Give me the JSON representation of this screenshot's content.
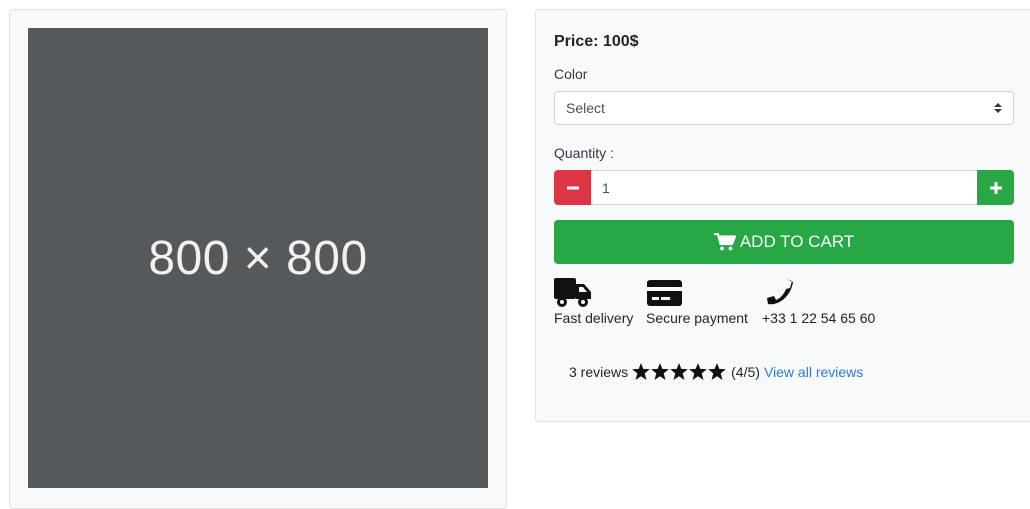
{
  "image_placeholder": {
    "label": "800 × 800"
  },
  "product": {
    "price_label": "Price: 100$",
    "color_label": "Color",
    "color_select_value": "Select",
    "quantity_label": "Quantity :",
    "quantity_value": "1",
    "add_to_cart_label": "ADD TO CART"
  },
  "features": [
    {
      "icon": "truck-icon",
      "label": "Fast delivery"
    },
    {
      "icon": "credit-card-icon",
      "label": "Secure payment"
    },
    {
      "icon": "phone-icon",
      "label": "+33 1 22 54 65 60"
    }
  ],
  "reviews": {
    "count_label": "3 reviews",
    "rating": 4,
    "max_rating": 5,
    "rating_label": "(4/5)",
    "view_all_label": "View all reviews"
  },
  "colors": {
    "danger": "#dc3545",
    "success": "#28a745",
    "link": "#2a7ae2",
    "placeholder": "#55595c"
  }
}
